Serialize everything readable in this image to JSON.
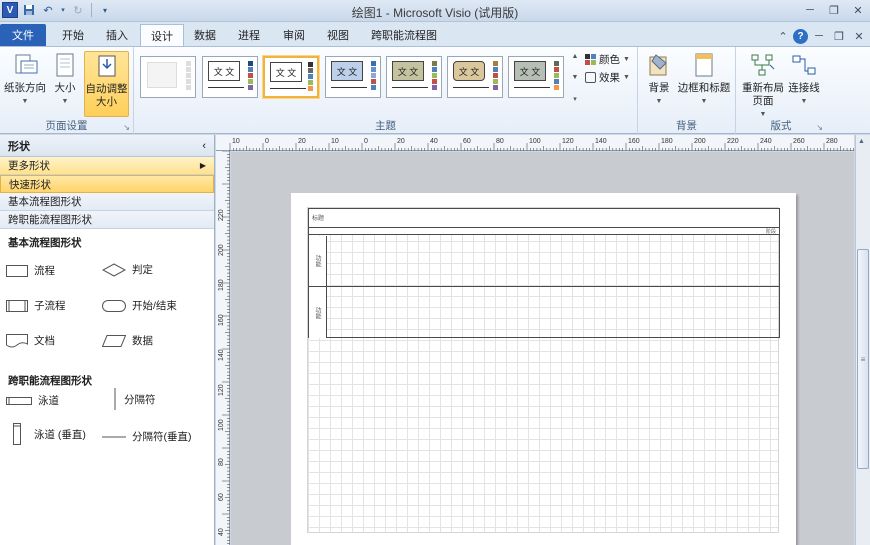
{
  "app": {
    "icon_letter": "V",
    "title": "绘图1  -  Microsoft Visio (试用版)"
  },
  "tabs": [
    {
      "label": "文件"
    },
    {
      "label": "开始"
    },
    {
      "label": "插入"
    },
    {
      "label": "设计"
    },
    {
      "label": "数据"
    },
    {
      "label": "进程"
    },
    {
      "label": "审阅"
    },
    {
      "label": "视图"
    },
    {
      "label": "跨职能流程图"
    }
  ],
  "ribbon": {
    "page_setup": {
      "label": "页面设置",
      "orientation": "纸张方向",
      "size": "大小",
      "autofit_line1": "自动调整",
      "autofit_line2": "大小"
    },
    "themes": {
      "label": "主题",
      "sample_text": "文 文",
      "colors": "颜色",
      "effects": "效果"
    },
    "backgrounds": {
      "label": "背景",
      "background": "背景",
      "borders": "边框和标题"
    },
    "layout": {
      "label": "版式",
      "relayout_line1": "重新布局",
      "relayout_line2": "页面",
      "connectors": "连接线"
    }
  },
  "shapes_pane": {
    "title": "形状",
    "stencils": [
      "更多形状",
      "快速形状",
      "基本流程图形状",
      "跨职能流程图形状"
    ],
    "basic_title": "基本流程图形状",
    "basic_shapes": [
      "流程",
      "判定",
      "子流程",
      "开始/结束",
      "文档",
      "数据"
    ],
    "cff_title": "跨职能流程图形状",
    "cff_shapes": [
      "泳道",
      "分隔符",
      "泳道 (垂直)",
      "分隔符(垂直)"
    ]
  },
  "rulers": {
    "top_ticks": [
      "10",
      "0",
      "20",
      "10",
      "0",
      "20",
      "40",
      "60",
      "80",
      "100",
      "120",
      "140",
      "160",
      "180",
      "200",
      "220",
      "240",
      "260",
      "280",
      "300"
    ],
    "left_ticks": [
      "220",
      "200",
      "180",
      "160",
      "140",
      "120",
      "100",
      "80",
      "60",
      "40",
      "20"
    ]
  },
  "diagram": {
    "title_text": "标题",
    "sub_text": "阶段",
    "lanes": [
      "功能",
      "功能"
    ]
  },
  "colors": {
    "file_tab": "#2a62b8",
    "highlight": "#ffcf5a",
    "ribbon_bg": "#e6eef8"
  }
}
